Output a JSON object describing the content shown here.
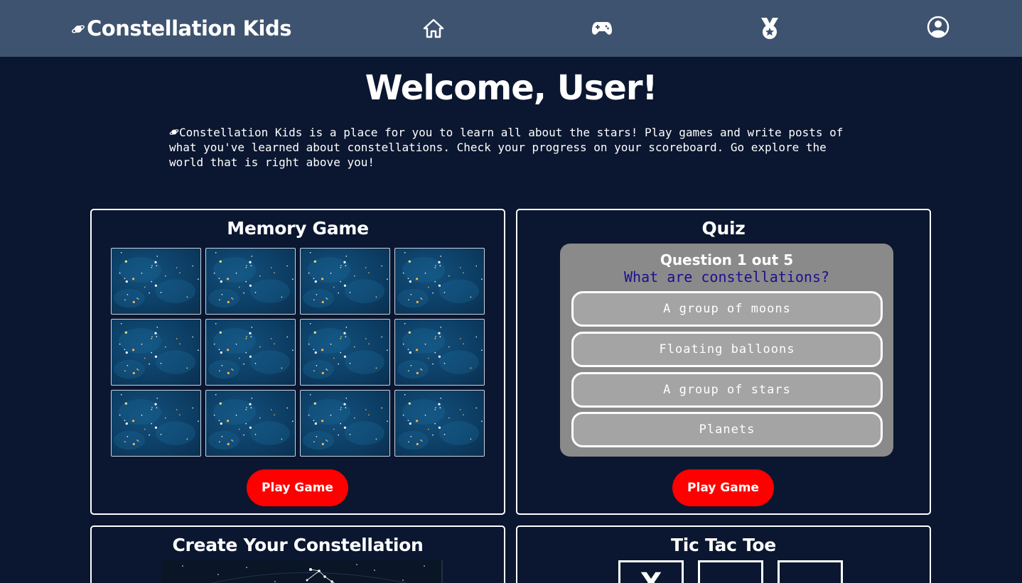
{
  "nav": {
    "brand": "Constellation Kids",
    "icons": [
      "planet-icon",
      "home-icon",
      "gamepad-icon",
      "medal-icon",
      "user-icon"
    ]
  },
  "welcome": {
    "title": "Welcome, User!",
    "intro": "Constellation Kids is a place for you to learn all about the stars! Play games and write posts of what you've learned about constellations. Check your progress on your scoreboard. Go explore the world that is right above you!"
  },
  "memory": {
    "title": "Memory Game",
    "play_label": "Play Game",
    "card_count": 12
  },
  "quiz": {
    "title": "Quiz",
    "progress": "Question 1 out 5",
    "question": "What are constellations?",
    "options": [
      "A group of moons",
      "Floating balloons",
      "A group of stars",
      "Planets"
    ],
    "play_label": "Play Game"
  },
  "create": {
    "title": "Create Your Constellation"
  },
  "tictactoe": {
    "title": "Tic Tac Toe",
    "cells": [
      "X",
      "",
      ""
    ]
  },
  "colors": {
    "background": "#0b1730",
    "navbar": "#3e536f",
    "accent": "#ff0000",
    "quiz_panel": "#8a8a8a",
    "quiz_question": "#1e0f8f"
  }
}
